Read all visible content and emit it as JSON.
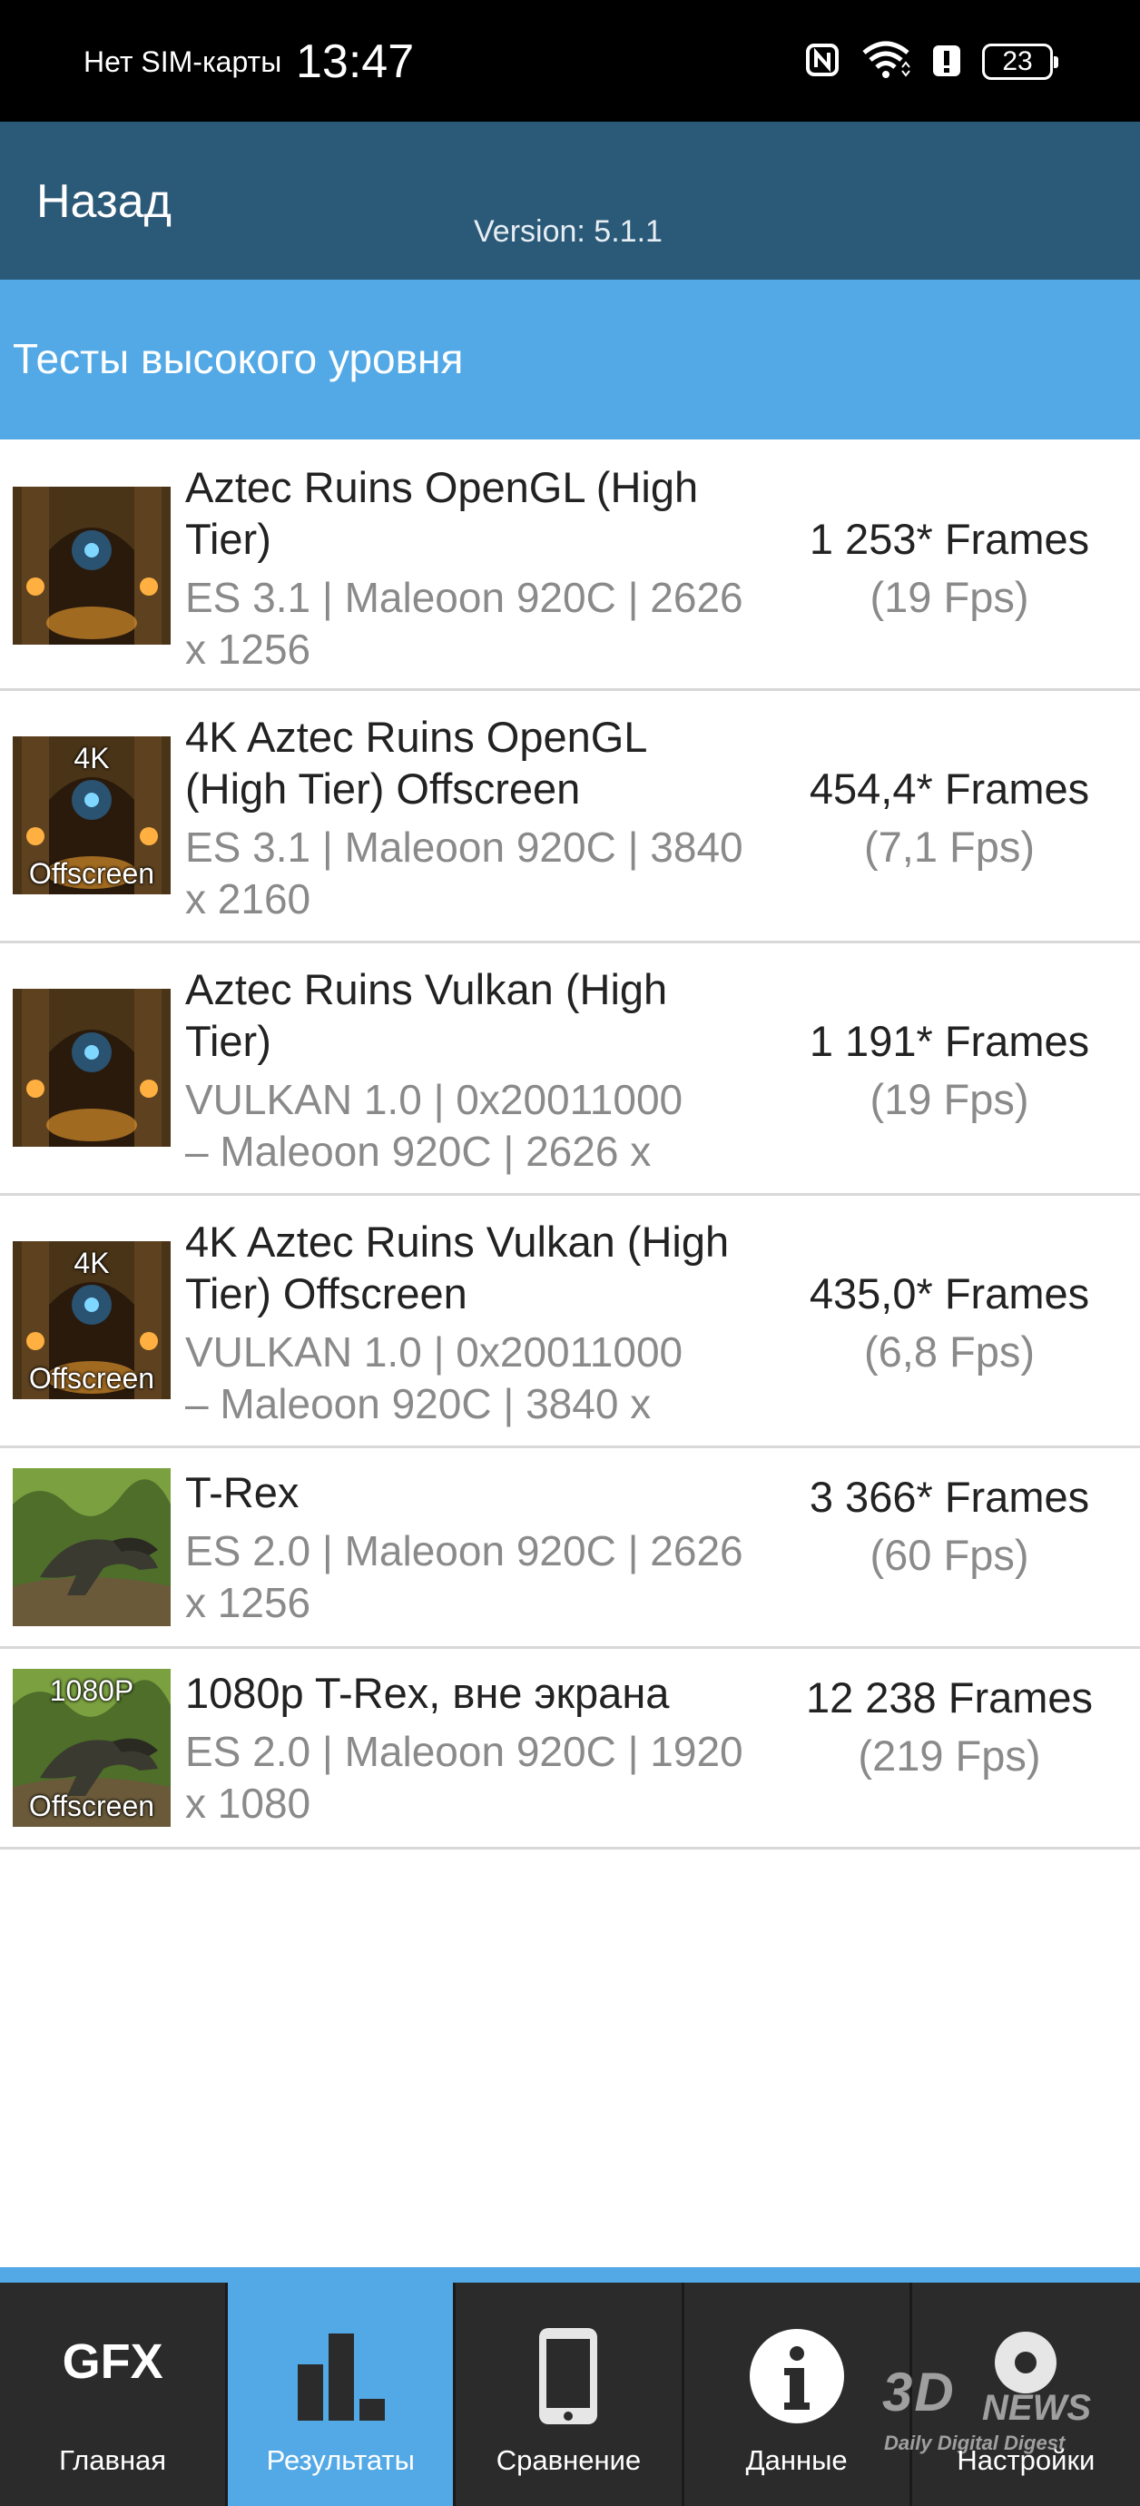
{
  "status_bar": {
    "carrier": "Нет SIM-карты",
    "time": "13:47",
    "battery": "23",
    "icons": [
      "nfc-icon",
      "wifi-icon",
      "alert-icon",
      "battery-icon"
    ]
  },
  "app_bar": {
    "back_label": "Назад",
    "version": "Version: 5.1.1",
    "color": "#2b5978"
  },
  "section": {
    "title": "Тесты высокого уровня",
    "color": "#52a9e6"
  },
  "results": [
    {
      "title": "Aztec Ruins OpenGL (High Tier)",
      "subtitle": "ES 3.1 | Maleoon 920C | 2626 x 1256",
      "frames": "1 253* Frames",
      "fps": "(19 Fps)",
      "thumb_top": "",
      "thumb_bottom": ""
    },
    {
      "title": "4K Aztec Ruins OpenGL (High Tier) Offscreen",
      "subtitle": "ES 3.1 | Maleoon 920C | 3840 x 2160",
      "frames": "454,4* Frames",
      "fps": "(7,1 Fps)",
      "thumb_top": "4K",
      "thumb_bottom": "Offscreen"
    },
    {
      "title": "Aztec Ruins Vulkan (High Tier)",
      "subtitle_line1": "VULKAN 1.0 | 0x20011000",
      "subtitle_line2": "– Maleoon 920C | 2626 x",
      "frames": "1 191* Frames",
      "fps": "(19 Fps)",
      "thumb_top": "",
      "thumb_bottom": ""
    },
    {
      "title": "4K Aztec Ruins Vulkan (High Tier) Offscreen",
      "subtitle_line1": "VULKAN 1.0 | 0x20011000",
      "subtitle_line2": "– Maleoon 920C | 3840 x",
      "frames": "435,0* Frames",
      "fps": "(6,8 Fps)",
      "thumb_top": "4K",
      "thumb_bottom": "Offscreen"
    },
    {
      "title": "T-Rex",
      "subtitle": "ES 2.0 | Maleoon 920C | 2626 x 1256",
      "frames": "3 366* Frames",
      "fps": "(60 Fps)",
      "thumb_top": "",
      "thumb_bottom": ""
    },
    {
      "title": "1080p T-Rex, вне экрана",
      "subtitle": "ES 2.0 | Maleoon 920C | 1920 x 1080",
      "frames": "12 238 Frames",
      "fps": "(219 Fps)",
      "thumb_top": "1080P",
      "thumb_bottom": "Offscreen"
    }
  ],
  "bottom_nav": {
    "items": [
      {
        "label": "Главная",
        "icon": "gfx-logo-icon",
        "logo_text": "GFX"
      },
      {
        "label": "Результаты",
        "icon": "bar-chart-icon"
      },
      {
        "label": "Сравнение",
        "icon": "phone-icon"
      },
      {
        "label": "Данные",
        "icon": "info-icon"
      },
      {
        "label": "Настройки",
        "icon": "settings-icon"
      }
    ],
    "active_color": "#52a9e6"
  },
  "watermark": {
    "logo": "3D",
    "news": "NEWS",
    "tagline": "Daily Digital Digest"
  }
}
